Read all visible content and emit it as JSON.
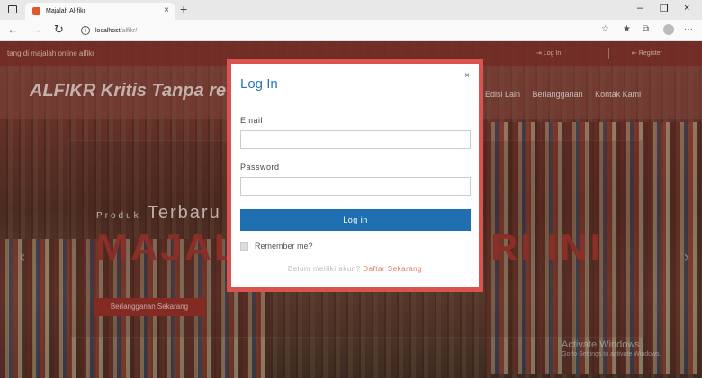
{
  "browser": {
    "tab_title": "Majalah Al-fikr",
    "tab_close": "×",
    "new_tab": "+",
    "url_host": "localhost",
    "url_path": "/alfikr/",
    "win_minimize": "–",
    "win_maximize": "❐",
    "win_close": "×",
    "menu_more": "···"
  },
  "topbar": {
    "tagline": "tang di majalah online alfikr",
    "login": "Log In",
    "register": "Register"
  },
  "navbar": {
    "brand": "ALFIKR Kritis Tanpa re",
    "menu": [
      "Edisi Lain",
      "Berlangganan",
      "Kontak Kami"
    ]
  },
  "hero": {
    "produk_prefix": "Produk",
    "produk_word": "Terbaru",
    "big_left": "MAJALAH",
    "big_right": "RI INI",
    "cta": "Berlangganan Sekarang",
    "prev": "‹",
    "next": "›"
  },
  "watermark": {
    "title": "Activate Windows",
    "subtitle": "Go to Settings to activate Windows."
  },
  "modal": {
    "title": "Log In",
    "close": "×",
    "email_label": "Email",
    "email_value": "",
    "password_label": "Password",
    "password_value": "",
    "submit": "Log in",
    "remember": "Remember me?",
    "no_account": "Belum meiliki akun?",
    "signup_link": "Daftar Sekarang"
  },
  "colors": {
    "accent": "#d9534f",
    "primary": "#1f6fb2",
    "title_blue": "#2a74c1",
    "hero_red": "#a83a30"
  }
}
